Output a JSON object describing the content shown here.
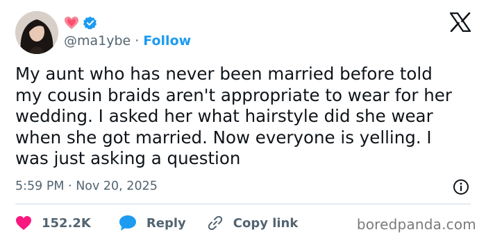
{
  "author": {
    "handle": "@ma1ybe",
    "separator": "·",
    "follow_label": "Follow",
    "name_emoji": "heart-emoji",
    "badge": "verified-badge"
  },
  "tweet": {
    "text": "My aunt who has never been married before told\nmy cousin braids aren't appropriate to wear for her\nwedding. I asked her what hairstyle did she wear\nwhen she got married. Now everyone is yelling. I\nwas just asking a question",
    "timestamp": "5:59 PM · Nov 20, 2025"
  },
  "actions": {
    "like_count": "152.2K",
    "reply_label": "Reply",
    "copy_link_label": "Copy link"
  },
  "watermark": "boredpanda.com",
  "colors": {
    "accent": "#1d9bf0",
    "like": "#f91880",
    "text": "#0f1419",
    "muted": "#536471"
  },
  "icons": [
    "x-logo-icon",
    "info-icon",
    "heart-icon",
    "reply-bubble-icon",
    "link-icon"
  ]
}
